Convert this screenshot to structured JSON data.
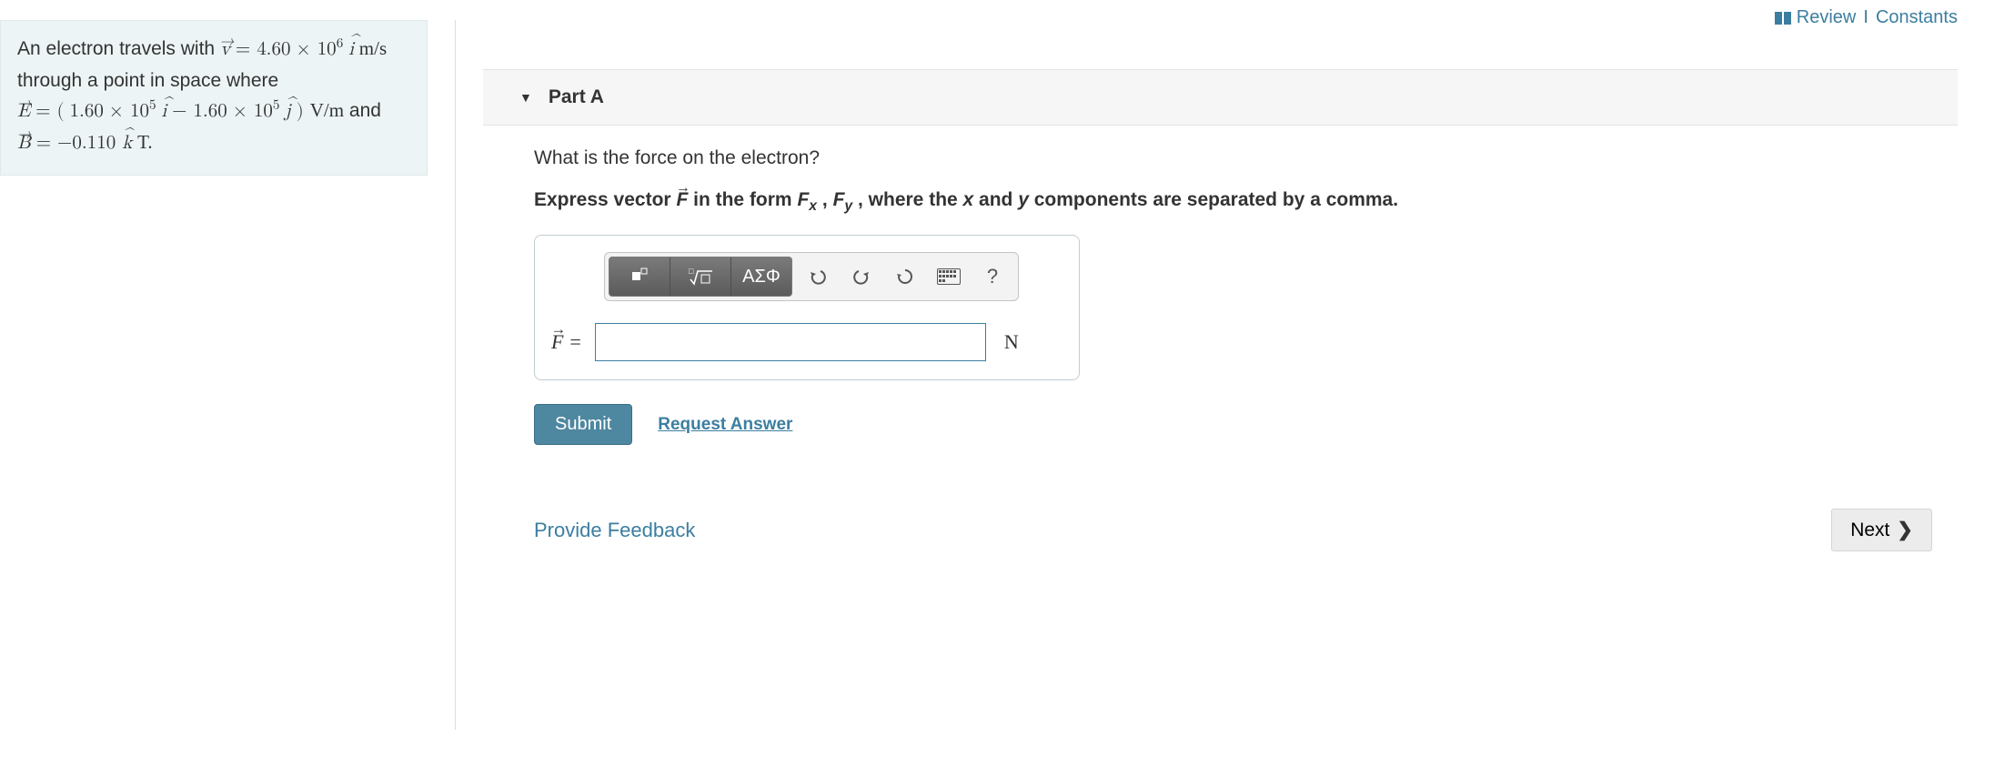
{
  "top_links": {
    "review": "Review",
    "sep": "I",
    "constants": "Constants"
  },
  "problem": {
    "intro1_a": "An electron travels with ",
    "v_sym": "v",
    "eq": " = ",
    "v_coeff": "4.60",
    "times": " × ",
    "v_exp_base": "10",
    "v_exp": "6",
    "i_hat": "i",
    "v_unit": " m/s",
    "intro1_b": "through a point in space where",
    "E_sym": "E",
    "E_open": " = (",
    "E1_coeff": "1.60",
    "E1_base": "10",
    "E1_exp": "5",
    "minus": " − ",
    "E2_coeff": "1.60",
    "E2_base": "10",
    "E2_exp": "5",
    "j_hat": "j",
    "E_close": ") ",
    "E_unit": "V/m",
    "and": " and",
    "B_sym": "B",
    "B_eq": " = ",
    "B_val": "−0.110 ",
    "k_hat": "k",
    "B_unit": " T."
  },
  "part": {
    "title": "Part A",
    "question": "What is the force on the electron?",
    "instr_a": "Express vector ",
    "instr_b": " in the form ",
    "Fx": "F",
    "sub_x": "x",
    "comma": ", ",
    "Fy": "F",
    "sub_y": "y",
    "instr_c": ", where the ",
    "var_x": "x",
    "instr_d": " and ",
    "var_y": "y",
    "instr_e": " components are separated by a comma.",
    "F_sym": "F",
    "answer": {
      "label_eq": " = ",
      "value": "",
      "unit": "N"
    },
    "toolbar": {
      "templates": "□",
      "radicals": "√□",
      "greek": "ΑΣΦ",
      "undo": "↶",
      "redo": "↷",
      "reset": "↺",
      "keyboard": "kbd",
      "help": "?"
    },
    "submit": "Submit",
    "request_answer": "Request Answer"
  },
  "footer": {
    "feedback": "Provide Feedback",
    "next": "Next"
  }
}
